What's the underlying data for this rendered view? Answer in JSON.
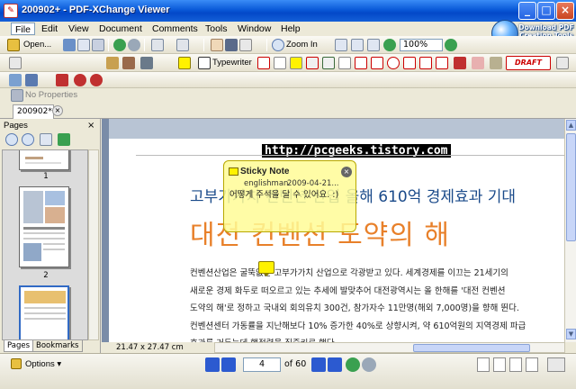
{
  "window": {
    "title": "200902+ - PDF-XChange Viewer",
    "minimize": "_",
    "maximize": "□",
    "close": "×"
  },
  "menu": [
    "File",
    "Edit",
    "View",
    "Document",
    "Comments",
    "Tools",
    "Window",
    "Help"
  ],
  "promo": {
    "text": "Download PDF Creation Tools"
  },
  "toolbar1": {
    "open_label": "Open...",
    "zoom_in_label": "Zoom In",
    "zoom_value": "100%"
  },
  "toolbar2": {
    "typewriter_label": "Typewriter",
    "draft_stamp": "DRAFT"
  },
  "toolbar4": {
    "no_properties": "No Properties"
  },
  "doc_tab": {
    "label": "200902*",
    "close": "×"
  },
  "left_pane": {
    "title": "Pages",
    "close": "×",
    "thumbnails": [
      {
        "page": "1"
      },
      {
        "page": "2"
      }
    ],
    "tabs": [
      "Pages",
      "Bookmarks"
    ]
  },
  "document": {
    "watermark": "http://pcgeeks.tistory.com",
    "heading": "고부가가치 컨벤션 산업 올해 610억 경제효과 기대",
    "big_heading": "대전 컨벤션 도약의 해",
    "body": [
      "컨벤션산업은 굴뚝없는 고부가가치 산업으로 각광받고 있다. 세계경제를 이끄는 21세기의",
      "새로운 경제 화두로 떠오르고 있는 추세에 발맞추어 대전광역시는 올 한해를 '대전 컨벤션",
      "도약의 해'로 정하고 국내외 회의유치 300건, 참가자수 11만명(해외 7,000명)을 향해 뛴다.",
      "컨벤션센터 가동률을 지난해보다 10% 증가한 40%로 상향시켜, 약 610억원의 지역경제 파급",
      "효과를 거두는데 행정력을 집중키로 했다."
    ]
  },
  "sticky_note": {
    "title": "Sticky Note",
    "author": "englishman",
    "date": "2009-04-21...",
    "body": "어떻게 주석을 달 수 있어요. :)",
    "close": "×"
  },
  "page_size": "21.47 x 27.47 cm",
  "status": {
    "options_label": "Options",
    "current_page": "4",
    "page_count": "of 60"
  },
  "colors": {
    "titlebar": "#0a5ad8",
    "heading": "#1a4a8a",
    "big_heading": "#e8802a",
    "sticky": "#fffc96"
  }
}
